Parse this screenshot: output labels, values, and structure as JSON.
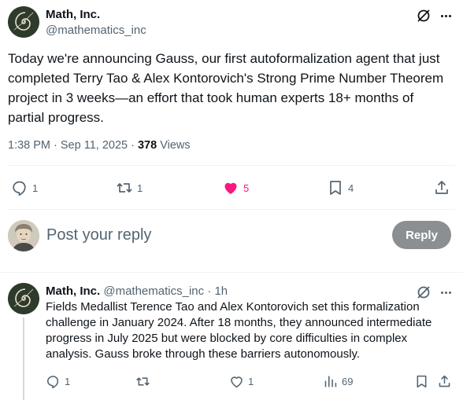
{
  "main_tweet": {
    "author_name": "Math, Inc.",
    "handle": "@mathematics_inc",
    "text": "Today we're announcing Gauss, our first autoformalization agent that just completed Terry Tao & Alex Kontorovich's Strong Prime Number Theorem project in 3 weeks—an effort that took human experts 18+ months of partial progress.",
    "time": "1:38 PM · Sep 11, 2025 · ",
    "views_count": "378",
    "views_label": " Views",
    "actions": {
      "replies": "1",
      "reposts": "1",
      "likes": "5",
      "bookmarks": "4"
    },
    "like_color": "#f91880"
  },
  "composer": {
    "placeholder": "Post your reply",
    "button_label": "Reply"
  },
  "reply_tweet": {
    "author_name": "Math, Inc.",
    "handle": "@mathematics_inc",
    "dot": "·",
    "time": "1h",
    "text": "Fields Medallist Terence Tao and Alex Kontorovich set this formalization challenge in January 2024. After 18 months, they announced intermediate progress in July 2025 but were blocked by core difficulties in complex analysis. Gauss broke through these barriers autonomously.",
    "actions": {
      "replies": "1",
      "reposts": "",
      "likes": "1",
      "views": "69"
    }
  }
}
